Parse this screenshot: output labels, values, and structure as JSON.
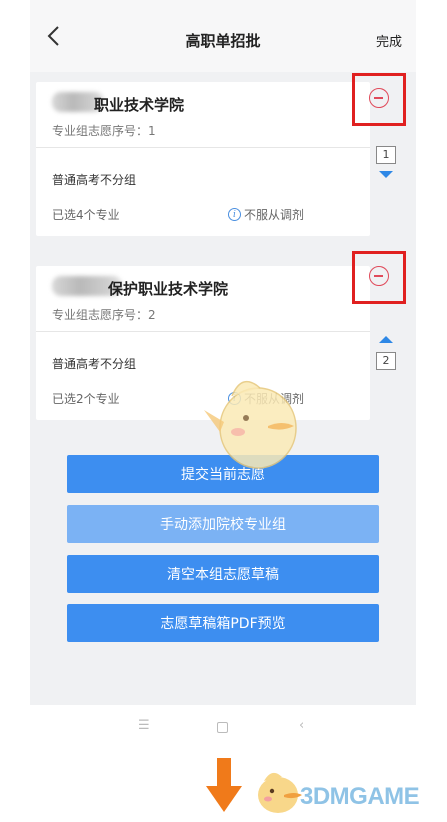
{
  "header": {
    "title": "高职单招批",
    "done_label": "完成"
  },
  "cards": [
    {
      "school_name": "职业技术学院",
      "group_seq": "专业组志愿序号：1",
      "group_type": "普通高考不分组",
      "selected_count": "已选4个专业",
      "not_adjust": "不服从调剂",
      "order": "1"
    },
    {
      "school_name": "保护职业技术学院",
      "group_seq": "专业组志愿序号：2",
      "group_type": "普通高考不分组",
      "selected_count": "已选2个专业",
      "not_adjust": "不服从调剂",
      "order": "2"
    }
  ],
  "actions": {
    "submit": "提交当前志愿",
    "manual_add": "手动添加院校专业组",
    "clear": "清空本组志愿草稿",
    "pdf_preview": "志愿草稿箱PDF预览"
  },
  "watermark": {
    "text": "3DMGAME"
  },
  "colors": {
    "primary": "#3d8ef0",
    "primary_light": "#7bb2f4",
    "highlight_red": "#e02020",
    "arrow_orange": "#f07a1a",
    "watermark_blue": "#8fc3e6"
  },
  "icons": [
    "back-chevron-icon",
    "remove-circle-icon",
    "info-icon",
    "arrow-down-icon",
    "arrow-up-icon",
    "menu-icon",
    "home-icon",
    "back-icon"
  ]
}
